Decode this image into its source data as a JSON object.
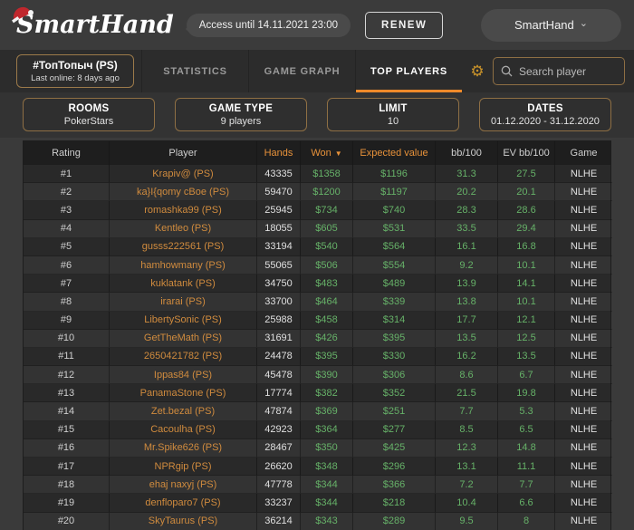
{
  "header": {
    "logo": "SmartHand",
    "access_label": "Access until 14.11.2021 23:00",
    "renew_label": "RENEW",
    "account_label": "SmartHand"
  },
  "nav": {
    "player_box": {
      "title": "#ТопТопыч (PS)",
      "subtitle": "Last online: 8 days ago"
    },
    "tabs": [
      {
        "label": "STATISTICS",
        "active": false
      },
      {
        "label": "GAME GRAPH",
        "active": false
      },
      {
        "label": "TOP PLAYERS",
        "active": true
      }
    ],
    "search_placeholder": "Search player"
  },
  "filters": [
    {
      "label": "ROOMS",
      "value": "PokerStars"
    },
    {
      "label": "GAME TYPE",
      "value": "9 players"
    },
    {
      "label": "LIMIT",
      "value": "10"
    },
    {
      "label": "DATES",
      "value": "01.12.2020 - 31.12.2020"
    }
  ],
  "table": {
    "columns": [
      "Rating",
      "Player",
      "Hands",
      "Won",
      "Expected value",
      "bb/100",
      "EV bb/100",
      "Game"
    ],
    "sort_column": "Won",
    "sort_direction": "desc",
    "rows": [
      [
        "#1",
        "Krapiv@ (PS)",
        "43335",
        "$1358",
        "$1196",
        "31.3",
        "27.5",
        "NLHE"
      ],
      [
        "#2",
        "ka}I{qomy cBoe (PS)",
        "59470",
        "$1200",
        "$1197",
        "20.2",
        "20.1",
        "NLHE"
      ],
      [
        "#3",
        "romashka99 (PS)",
        "25945",
        "$734",
        "$740",
        "28.3",
        "28.6",
        "NLHE"
      ],
      [
        "#4",
        "Kentleo (PS)",
        "18055",
        "$605",
        "$531",
        "33.5",
        "29.4",
        "NLHE"
      ],
      [
        "#5",
        "gusss222561 (PS)",
        "33194",
        "$540",
        "$564",
        "16.1",
        "16.8",
        "NLHE"
      ],
      [
        "#6",
        "hamhowmany (PS)",
        "55065",
        "$506",
        "$554",
        "9.2",
        "10.1",
        "NLHE"
      ],
      [
        "#7",
        "kuklatank (PS)",
        "34750",
        "$483",
        "$489",
        "13.9",
        "14.1",
        "NLHE"
      ],
      [
        "#8",
        "irarai (PS)",
        "33700",
        "$464",
        "$339",
        "13.8",
        "10.1",
        "NLHE"
      ],
      [
        "#9",
        "LibertySonic (PS)",
        "25988",
        "$458",
        "$314",
        "17.7",
        "12.1",
        "NLHE"
      ],
      [
        "#10",
        "GetTheMath (PS)",
        "31691",
        "$426",
        "$395",
        "13.5",
        "12.5",
        "NLHE"
      ],
      [
        "#11",
        "2650421782 (PS)",
        "24478",
        "$395",
        "$330",
        "16.2",
        "13.5",
        "NLHE"
      ],
      [
        "#12",
        "Ippas84 (PS)",
        "45478",
        "$390",
        "$306",
        "8.6",
        "6.7",
        "NLHE"
      ],
      [
        "#13",
        "PanamaStone (PS)",
        "17774",
        "$382",
        "$352",
        "21.5",
        "19.8",
        "NLHE"
      ],
      [
        "#14",
        "Zet.bezal (PS)",
        "47874",
        "$369",
        "$251",
        "7.7",
        "5.3",
        "NLHE"
      ],
      [
        "#15",
        "Cacoulha (PS)",
        "42923",
        "$364",
        "$277",
        "8.5",
        "6.5",
        "NLHE"
      ],
      [
        "#16",
        "Mr.Spike626 (PS)",
        "28467",
        "$350",
        "$425",
        "12.3",
        "14.8",
        "NLHE"
      ],
      [
        "#17",
        "NPRgip (PS)",
        "26620",
        "$348",
        "$296",
        "13.1",
        "11.1",
        "NLHE"
      ],
      [
        "#18",
        "ehaj naxyj (PS)",
        "47778",
        "$344",
        "$366",
        "7.2",
        "7.7",
        "NLHE"
      ],
      [
        "#19",
        "denfloparo7 (PS)",
        "33237",
        "$344",
        "$218",
        "10.4",
        "6.6",
        "NLHE"
      ],
      [
        "#20",
        "SkyTaurus (PS)",
        "36214",
        "$343",
        "$289",
        "9.5",
        "8",
        "NLHE"
      ]
    ]
  },
  "colors": {
    "accent_orange": "#ef8a2a",
    "player_orange": "#d08b3e",
    "positive_green": "#66b168",
    "santa_hat_red": "#c0272d"
  }
}
